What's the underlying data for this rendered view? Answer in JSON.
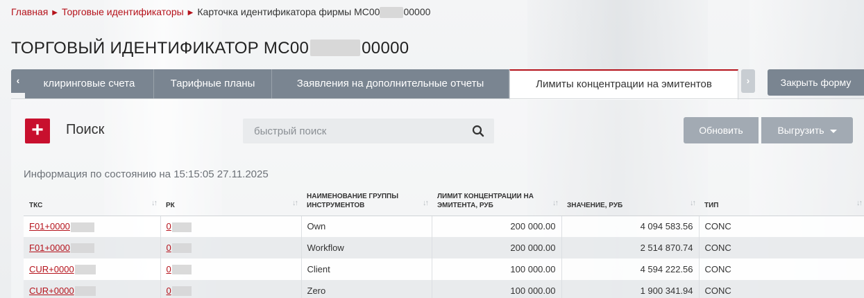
{
  "breadcrumb": {
    "home": "Главная",
    "section": "Торговые идентификаторы",
    "current_prefix": "Карточка идентификатора фирмы МС00",
    "current_suffix": "00000"
  },
  "title": {
    "prefix": "ТОРГОВЫЙ ИДЕНТИФИКАТОР МС00",
    "suffix": "00000"
  },
  "tabs": [
    {
      "label": "клиринговые счета",
      "active": false
    },
    {
      "label": "Тарифные планы",
      "active": false
    },
    {
      "label": "Заявления на дополнительные отчеты",
      "active": false
    },
    {
      "label": "Лимиты концентрации на эмитентов",
      "active": true
    }
  ],
  "tab_arrows": {
    "left": "‹",
    "right": "›"
  },
  "close_form_label": "Закрыть форму",
  "toolbar": {
    "add_label": "+",
    "search_label": "Поиск",
    "search_placeholder": "быстрый поиск",
    "refresh_label": "Обновить",
    "export_label": "Выгрузить"
  },
  "info_text": "Информация по состоянию на 15:15:05 27.11.2025",
  "table": {
    "columns": [
      {
        "label": "ТКС"
      },
      {
        "label": "РК"
      },
      {
        "label": "НАИМЕНОВАНИЕ ГРУППЫ ИНСТРУМЕНТОВ"
      },
      {
        "label": "ЛИМИТ КОНЦЕНТРАЦИИ НА ЭМИТЕНТА, РУБ"
      },
      {
        "label": "ЗНАЧЕНИЕ, РУБ"
      },
      {
        "label": "ТИП"
      }
    ],
    "rows": [
      {
        "tks": "F01+0000",
        "rk": "0",
        "group": "Own",
        "limit": "200 000.00",
        "value": "4 094 583.56",
        "type": "CONC"
      },
      {
        "tks": "F01+0000",
        "rk": "0",
        "group": "Workflow",
        "limit": "200 000.00",
        "value": "2 514 870.74",
        "type": "CONC"
      },
      {
        "tks": "CUR+0000",
        "rk": "0",
        "group": "Client",
        "limit": "100 000.00",
        "value": "4 594 222.56",
        "type": "CONC"
      },
      {
        "tks": "CUR+0000",
        "rk": "0",
        "group": "Zero",
        "limit": "100 000.00",
        "value": "1 900 341.94",
        "type": "CONC"
      }
    ]
  },
  "colors": {
    "accent": "#b5121b",
    "tab_bg": "#7a8591",
    "button_bg": "#a2aab3",
    "add_button": "#c8102e"
  },
  "icons": {
    "search": "search-icon",
    "add": "plus-icon",
    "export_caret": "caret-down-icon"
  }
}
